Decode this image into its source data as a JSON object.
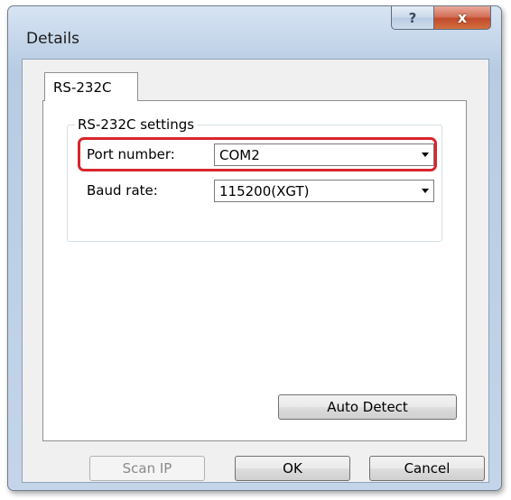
{
  "window": {
    "title": "Details",
    "help_label": "?",
    "close_label": "x"
  },
  "tabs": [
    {
      "label": "RS-232C",
      "selected": true
    }
  ],
  "settings_group": {
    "title": "RS-232C settings",
    "port": {
      "label": "Port number:",
      "value": "COM2"
    },
    "baud": {
      "label": "Baud rate:",
      "value": "115200(XGT)"
    }
  },
  "buttons": {
    "auto_detect": "Auto Detect",
    "scan_ip": "Scan IP",
    "ok": "OK",
    "cancel": "Cancel"
  },
  "colors": {
    "highlight": "#d8262c",
    "close_button": "#c24a2c"
  }
}
